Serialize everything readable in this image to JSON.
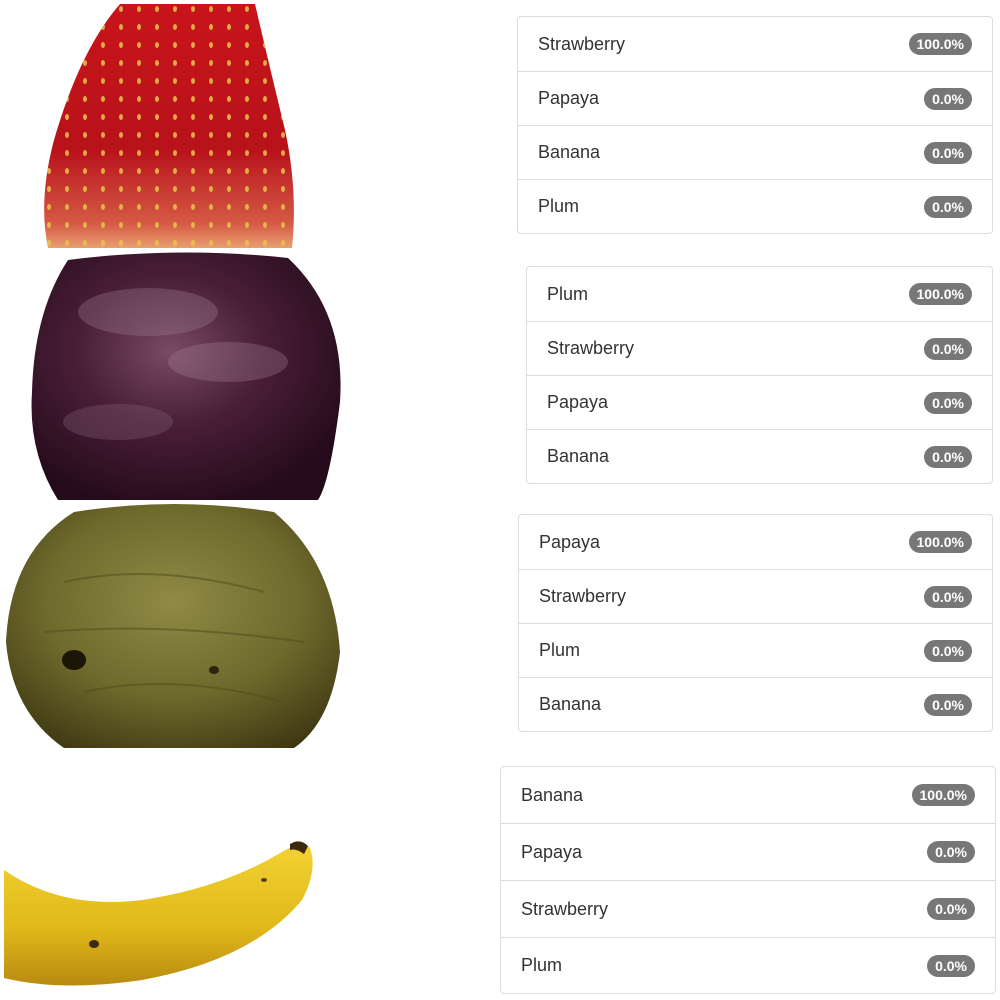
{
  "results": [
    {
      "image_subject": "strawberry",
      "predictions": [
        {
          "label": "Strawberry",
          "probability": "100.0%"
        },
        {
          "label": "Papaya",
          "probability": "0.0%"
        },
        {
          "label": "Banana",
          "probability": "0.0%"
        },
        {
          "label": "Plum",
          "probability": "0.0%"
        }
      ]
    },
    {
      "image_subject": "plum",
      "predictions": [
        {
          "label": "Plum",
          "probability": "100.0%"
        },
        {
          "label": "Strawberry",
          "probability": "0.0%"
        },
        {
          "label": "Papaya",
          "probability": "0.0%"
        },
        {
          "label": "Banana",
          "probability": "0.0%"
        }
      ]
    },
    {
      "image_subject": "papaya",
      "predictions": [
        {
          "label": "Papaya",
          "probability": "100.0%"
        },
        {
          "label": "Strawberry",
          "probability": "0.0%"
        },
        {
          "label": "Plum",
          "probability": "0.0%"
        },
        {
          "label": "Banana",
          "probability": "0.0%"
        }
      ]
    },
    {
      "image_subject": "banana",
      "predictions": [
        {
          "label": "Banana",
          "probability": "100.0%"
        },
        {
          "label": "Papaya",
          "probability": "0.0%"
        },
        {
          "label": "Strawberry",
          "probability": "0.0%"
        },
        {
          "label": "Plum",
          "probability": "0.0%"
        }
      ]
    }
  ]
}
